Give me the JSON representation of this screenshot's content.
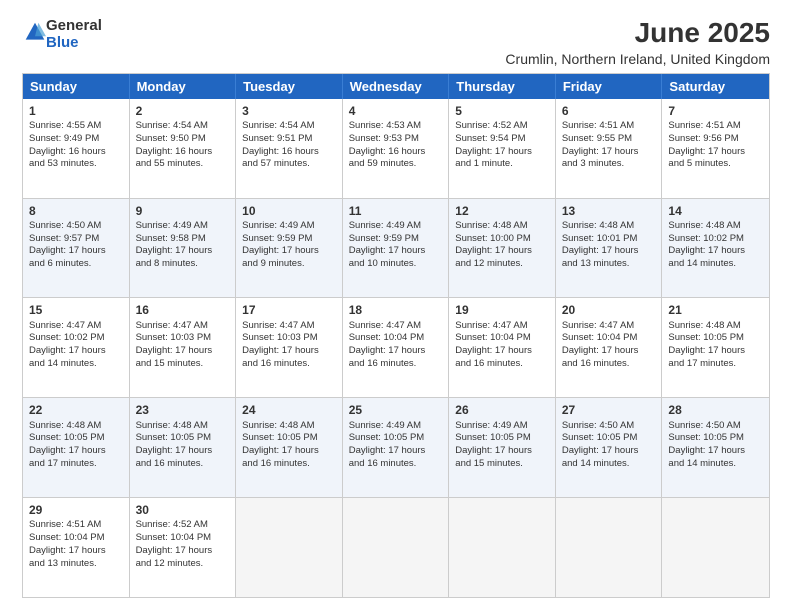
{
  "logo": {
    "general": "General",
    "blue": "Blue"
  },
  "header": {
    "title": "June 2025",
    "subtitle": "Crumlin, Northern Ireland, United Kingdom"
  },
  "days": [
    "Sunday",
    "Monday",
    "Tuesday",
    "Wednesday",
    "Thursday",
    "Friday",
    "Saturday"
  ],
  "rows": [
    [
      {
        "num": "1",
        "lines": [
          "Sunrise: 4:55 AM",
          "Sunset: 9:49 PM",
          "Daylight: 16 hours",
          "and 53 minutes."
        ]
      },
      {
        "num": "2",
        "lines": [
          "Sunrise: 4:54 AM",
          "Sunset: 9:50 PM",
          "Daylight: 16 hours",
          "and 55 minutes."
        ]
      },
      {
        "num": "3",
        "lines": [
          "Sunrise: 4:54 AM",
          "Sunset: 9:51 PM",
          "Daylight: 16 hours",
          "and 57 minutes."
        ]
      },
      {
        "num": "4",
        "lines": [
          "Sunrise: 4:53 AM",
          "Sunset: 9:53 PM",
          "Daylight: 16 hours",
          "and 59 minutes."
        ]
      },
      {
        "num": "5",
        "lines": [
          "Sunrise: 4:52 AM",
          "Sunset: 9:54 PM",
          "Daylight: 17 hours",
          "and 1 minute."
        ]
      },
      {
        "num": "6",
        "lines": [
          "Sunrise: 4:51 AM",
          "Sunset: 9:55 PM",
          "Daylight: 17 hours",
          "and 3 minutes."
        ]
      },
      {
        "num": "7",
        "lines": [
          "Sunrise: 4:51 AM",
          "Sunset: 9:56 PM",
          "Daylight: 17 hours",
          "and 5 minutes."
        ]
      }
    ],
    [
      {
        "num": "8",
        "lines": [
          "Sunrise: 4:50 AM",
          "Sunset: 9:57 PM",
          "Daylight: 17 hours",
          "and 6 minutes."
        ]
      },
      {
        "num": "9",
        "lines": [
          "Sunrise: 4:49 AM",
          "Sunset: 9:58 PM",
          "Daylight: 17 hours",
          "and 8 minutes."
        ]
      },
      {
        "num": "10",
        "lines": [
          "Sunrise: 4:49 AM",
          "Sunset: 9:59 PM",
          "Daylight: 17 hours",
          "and 9 minutes."
        ]
      },
      {
        "num": "11",
        "lines": [
          "Sunrise: 4:49 AM",
          "Sunset: 9:59 PM",
          "Daylight: 17 hours",
          "and 10 minutes."
        ]
      },
      {
        "num": "12",
        "lines": [
          "Sunrise: 4:48 AM",
          "Sunset: 10:00 PM",
          "Daylight: 17 hours",
          "and 12 minutes."
        ]
      },
      {
        "num": "13",
        "lines": [
          "Sunrise: 4:48 AM",
          "Sunset: 10:01 PM",
          "Daylight: 17 hours",
          "and 13 minutes."
        ]
      },
      {
        "num": "14",
        "lines": [
          "Sunrise: 4:48 AM",
          "Sunset: 10:02 PM",
          "Daylight: 17 hours",
          "and 14 minutes."
        ]
      }
    ],
    [
      {
        "num": "15",
        "lines": [
          "Sunrise: 4:47 AM",
          "Sunset: 10:02 PM",
          "Daylight: 17 hours",
          "and 14 minutes."
        ]
      },
      {
        "num": "16",
        "lines": [
          "Sunrise: 4:47 AM",
          "Sunset: 10:03 PM",
          "Daylight: 17 hours",
          "and 15 minutes."
        ]
      },
      {
        "num": "17",
        "lines": [
          "Sunrise: 4:47 AM",
          "Sunset: 10:03 PM",
          "Daylight: 17 hours",
          "and 16 minutes."
        ]
      },
      {
        "num": "18",
        "lines": [
          "Sunrise: 4:47 AM",
          "Sunset: 10:04 PM",
          "Daylight: 17 hours",
          "and 16 minutes."
        ]
      },
      {
        "num": "19",
        "lines": [
          "Sunrise: 4:47 AM",
          "Sunset: 10:04 PM",
          "Daylight: 17 hours",
          "and 16 minutes."
        ]
      },
      {
        "num": "20",
        "lines": [
          "Sunrise: 4:47 AM",
          "Sunset: 10:04 PM",
          "Daylight: 17 hours",
          "and 16 minutes."
        ]
      },
      {
        "num": "21",
        "lines": [
          "Sunrise: 4:48 AM",
          "Sunset: 10:05 PM",
          "Daylight: 17 hours",
          "and 17 minutes."
        ]
      }
    ],
    [
      {
        "num": "22",
        "lines": [
          "Sunrise: 4:48 AM",
          "Sunset: 10:05 PM",
          "Daylight: 17 hours",
          "and 17 minutes."
        ]
      },
      {
        "num": "23",
        "lines": [
          "Sunrise: 4:48 AM",
          "Sunset: 10:05 PM",
          "Daylight: 17 hours",
          "and 16 minutes."
        ]
      },
      {
        "num": "24",
        "lines": [
          "Sunrise: 4:48 AM",
          "Sunset: 10:05 PM",
          "Daylight: 17 hours",
          "and 16 minutes."
        ]
      },
      {
        "num": "25",
        "lines": [
          "Sunrise: 4:49 AM",
          "Sunset: 10:05 PM",
          "Daylight: 17 hours",
          "and 16 minutes."
        ]
      },
      {
        "num": "26",
        "lines": [
          "Sunrise: 4:49 AM",
          "Sunset: 10:05 PM",
          "Daylight: 17 hours",
          "and 15 minutes."
        ]
      },
      {
        "num": "27",
        "lines": [
          "Sunrise: 4:50 AM",
          "Sunset: 10:05 PM",
          "Daylight: 17 hours",
          "and 14 minutes."
        ]
      },
      {
        "num": "28",
        "lines": [
          "Sunrise: 4:50 AM",
          "Sunset: 10:05 PM",
          "Daylight: 17 hours",
          "and 14 minutes."
        ]
      }
    ],
    [
      {
        "num": "29",
        "lines": [
          "Sunrise: 4:51 AM",
          "Sunset: 10:04 PM",
          "Daylight: 17 hours",
          "and 13 minutes."
        ]
      },
      {
        "num": "30",
        "lines": [
          "Sunrise: 4:52 AM",
          "Sunset: 10:04 PM",
          "Daylight: 17 hours",
          "and 12 minutes."
        ]
      },
      {
        "num": "",
        "lines": []
      },
      {
        "num": "",
        "lines": []
      },
      {
        "num": "",
        "lines": []
      },
      {
        "num": "",
        "lines": []
      },
      {
        "num": "",
        "lines": []
      }
    ]
  ]
}
